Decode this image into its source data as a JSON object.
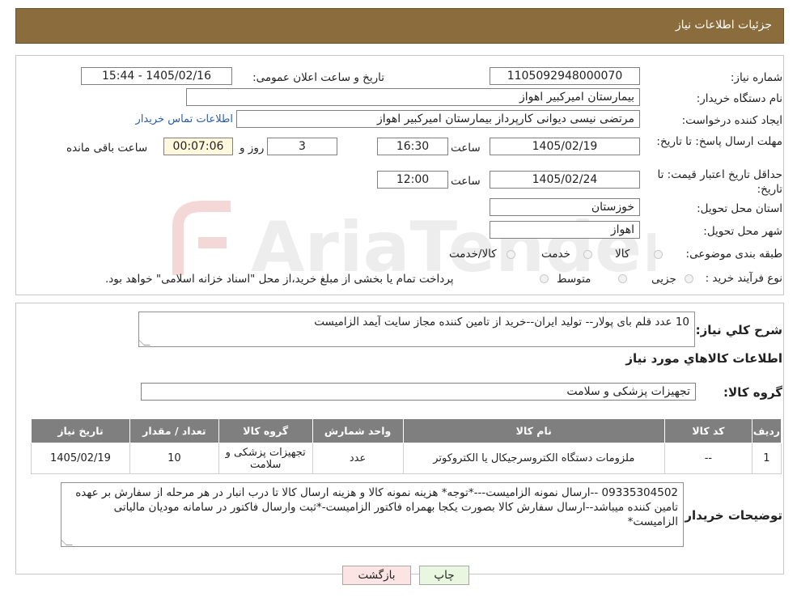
{
  "header": {
    "title": "جزئیات اطلاعات نیاز"
  },
  "form": {
    "need_number_label": "شماره نیاز:",
    "need_number": "1105092948000070",
    "announce_label": "تاریخ و ساعت اعلان عمومی:",
    "announce_value": "1405/02/16 - 15:44",
    "buyer_org_label": "نام دستگاه خریدار:",
    "buyer_org": "بیمارستان امیرکبیر اهواز",
    "creator_label": "ایجاد کننده درخواست:",
    "creator": "مرتضی نیسی دیوانی کارپرداز بیمارستان امیرکبیر اهواز",
    "contact_link": "اطلاعات تماس خریدار",
    "deadline_label": "مهلت ارسال پاسخ: تا تاریخ:",
    "deadline_date": "1405/02/19",
    "time_label": "ساعت",
    "deadline_time": "16:30",
    "days_value": "3",
    "days_label": "روز و",
    "remaining_time": "00:07:06",
    "remaining_label": "ساعت باقی مانده",
    "validity_label": "حداقل تاریخ اعتبار قیمت: تا تاریخ:",
    "validity_date": "1405/02/24",
    "validity_time": "12:00",
    "province_label": "استان محل تحویل:",
    "province": "خوزستان",
    "city_label": "شهر محل تحویل:",
    "city": "اهواز",
    "category_label": "طبقه بندی موضوعی:",
    "category_options": [
      "کالا",
      "خدمت",
      "کالا/خدمت"
    ],
    "process_label": "نوع فرآیند خرید :",
    "process_options": [
      "جزیی",
      "متوسط"
    ],
    "process_note": "پرداخت تمام یا بخشی از مبلغ خرید،از محل \"اسناد خزانه اسلامی\" خواهد بود."
  },
  "description": {
    "label": "شرح کلي نياز:",
    "text": "10 عدد قلم بای پولار-- تولید ایران--خرید از تامین کننده مجاز سایت آیمد الزامیست"
  },
  "goods": {
    "section_title": "اطلاعات کالاهاي مورد نياز",
    "group_label": "گروه کالا:",
    "group_value": "تجهیزات پزشکی و سلامت",
    "columns": [
      "ردیف",
      "کد کالا",
      "نام کالا",
      "واحد شمارش",
      "گروه کالا",
      "تعداد / مقدار",
      "تاریخ نیاز"
    ],
    "rows": [
      {
        "row": "1",
        "code": "--",
        "name": "ملزومات دستگاه الکتروسرجیکال یا الکتروکوتر",
        "unit": "عدد",
        "group": "تجهیزات پزشکی و سلامت",
        "qty": "10",
        "date": "1405/02/19"
      }
    ]
  },
  "buyer_notes": {
    "label": "توضیحات خریدار:",
    "text": "09335304502 --ارسال نمونه الزامیست---*توجه* هزینه نمونه کالا و هزینه ارسال کالا تا درب انبار در هر مرحله از سفارش بر عهده تامین کننده میباشد--ارسال سفارش کالا بصورت یکجا بهمراه فاکتور الزامیست-*ثبت وارسال فاکتور در سامانه مودیان مالیاتی الزامیست*"
  },
  "buttons": {
    "print": "چاپ",
    "back": "بازگشت"
  },
  "watermark": {
    "text": "AriaTender.neT"
  },
  "colors": {
    "header_bg": "#8b6d3d",
    "table_header_bg": "#7f7f7f",
    "back_button_bg": "#fce4e4",
    "print_button_bg": "#eaf7e0",
    "remaining_bg": "#fff8dc"
  }
}
